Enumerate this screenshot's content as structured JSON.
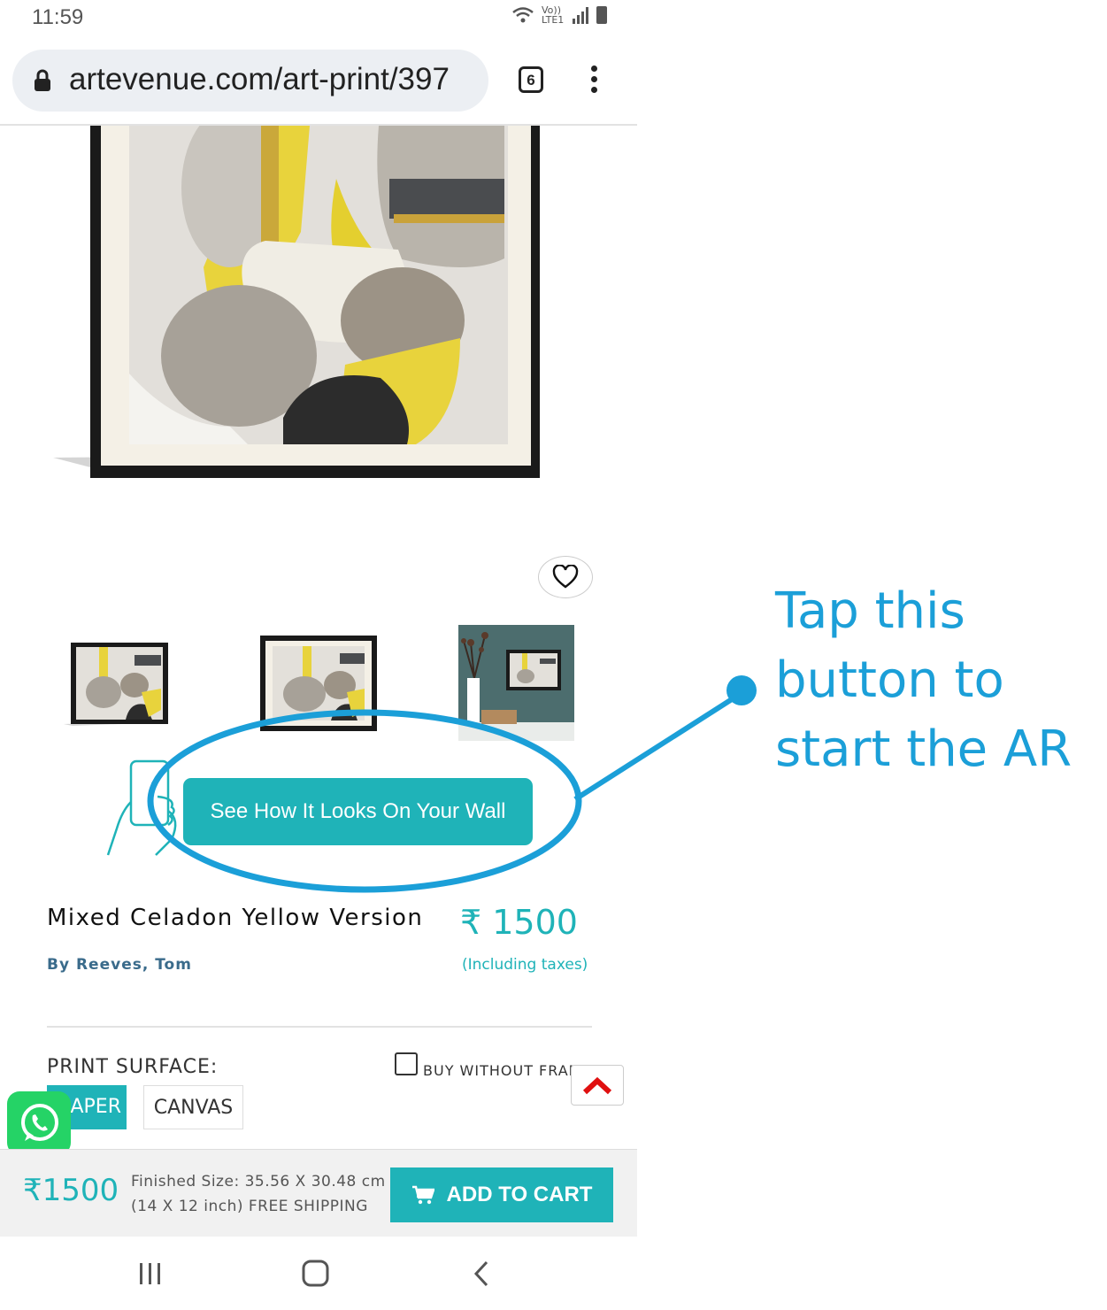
{
  "status_bar": {
    "time": "11:59",
    "network_label": "Vo)) LTE1"
  },
  "browser": {
    "url": "artevenue.com/art-print/397",
    "tab_count": "6"
  },
  "product": {
    "title": "Mixed Celadon Yellow Version",
    "author": "By Reeves, Tom",
    "price": "₹ 1500",
    "price_note": "(Including taxes)"
  },
  "ar": {
    "button_label": "See How It Looks On Your Wall"
  },
  "options": {
    "surface_label": "PRINT SURFACE:",
    "surface_options": [
      "APER",
      "CANVAS"
    ],
    "selected_surface": "APER",
    "frame_label": "BUY WITHOUT FRAME",
    "frame_checked": false
  },
  "cart_bar": {
    "price": "₹1500",
    "size_line1": "Finished Size: 35.56 X 30.48 cm",
    "size_line2": "(14 X 12 inch) FREE SHIPPING",
    "add_label": "ADD TO CART"
  },
  "callout": {
    "text": "Tap this\nbutton to\nstart the AR"
  },
  "colors": {
    "accent": "#1fb3b8",
    "annotation": "#1b9fd8",
    "whatsapp": "#25d366"
  },
  "icons": [
    "lock-icon",
    "tabs-icon",
    "menu-icon",
    "heart-icon",
    "phone-hand-icon",
    "whatsapp-icon",
    "chevron-up-icon",
    "cart-icon",
    "recent-apps-icon",
    "home-icon",
    "back-icon"
  ]
}
